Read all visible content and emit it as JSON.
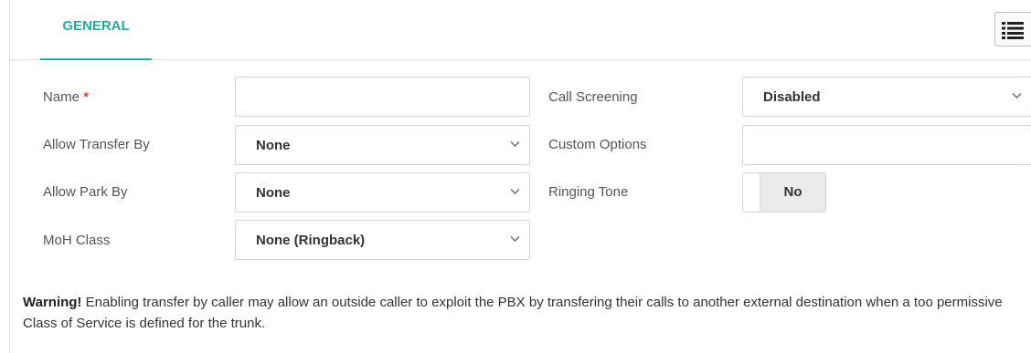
{
  "tabs": {
    "general_label": "GENERAL"
  },
  "header": {
    "list_icon": "list-icon"
  },
  "form": {
    "name": {
      "label": "Name",
      "required_mark": "*",
      "value": ""
    },
    "allow_transfer_by": {
      "label": "Allow Transfer By",
      "value": "None",
      "icon": "chevron-down-icon"
    },
    "allow_park_by": {
      "label": "Allow Park By",
      "value": "None",
      "icon": "chevron-down-icon"
    },
    "moh_class": {
      "label": "MoH Class",
      "value": "None (Ringback)",
      "icon": "chevron-down-icon"
    },
    "call_screening": {
      "label": "Call Screening",
      "value": "Disabled",
      "icon": "chevron-down-icon"
    },
    "custom_options": {
      "label": "Custom Options",
      "value": ""
    },
    "ringing_tone": {
      "label": "Ringing Tone",
      "value": "No",
      "enabled": false
    }
  },
  "warning": {
    "title": "Warning!",
    "text": " Enabling transfer by caller may allow an outside caller to exploit the PBX by transfering their calls to another external destination when a too permissive Class of Service is defined for the trunk."
  },
  "colors": {
    "accent": "#2aa8a0",
    "required": "#e2403b",
    "border": "#d4d4d4"
  }
}
